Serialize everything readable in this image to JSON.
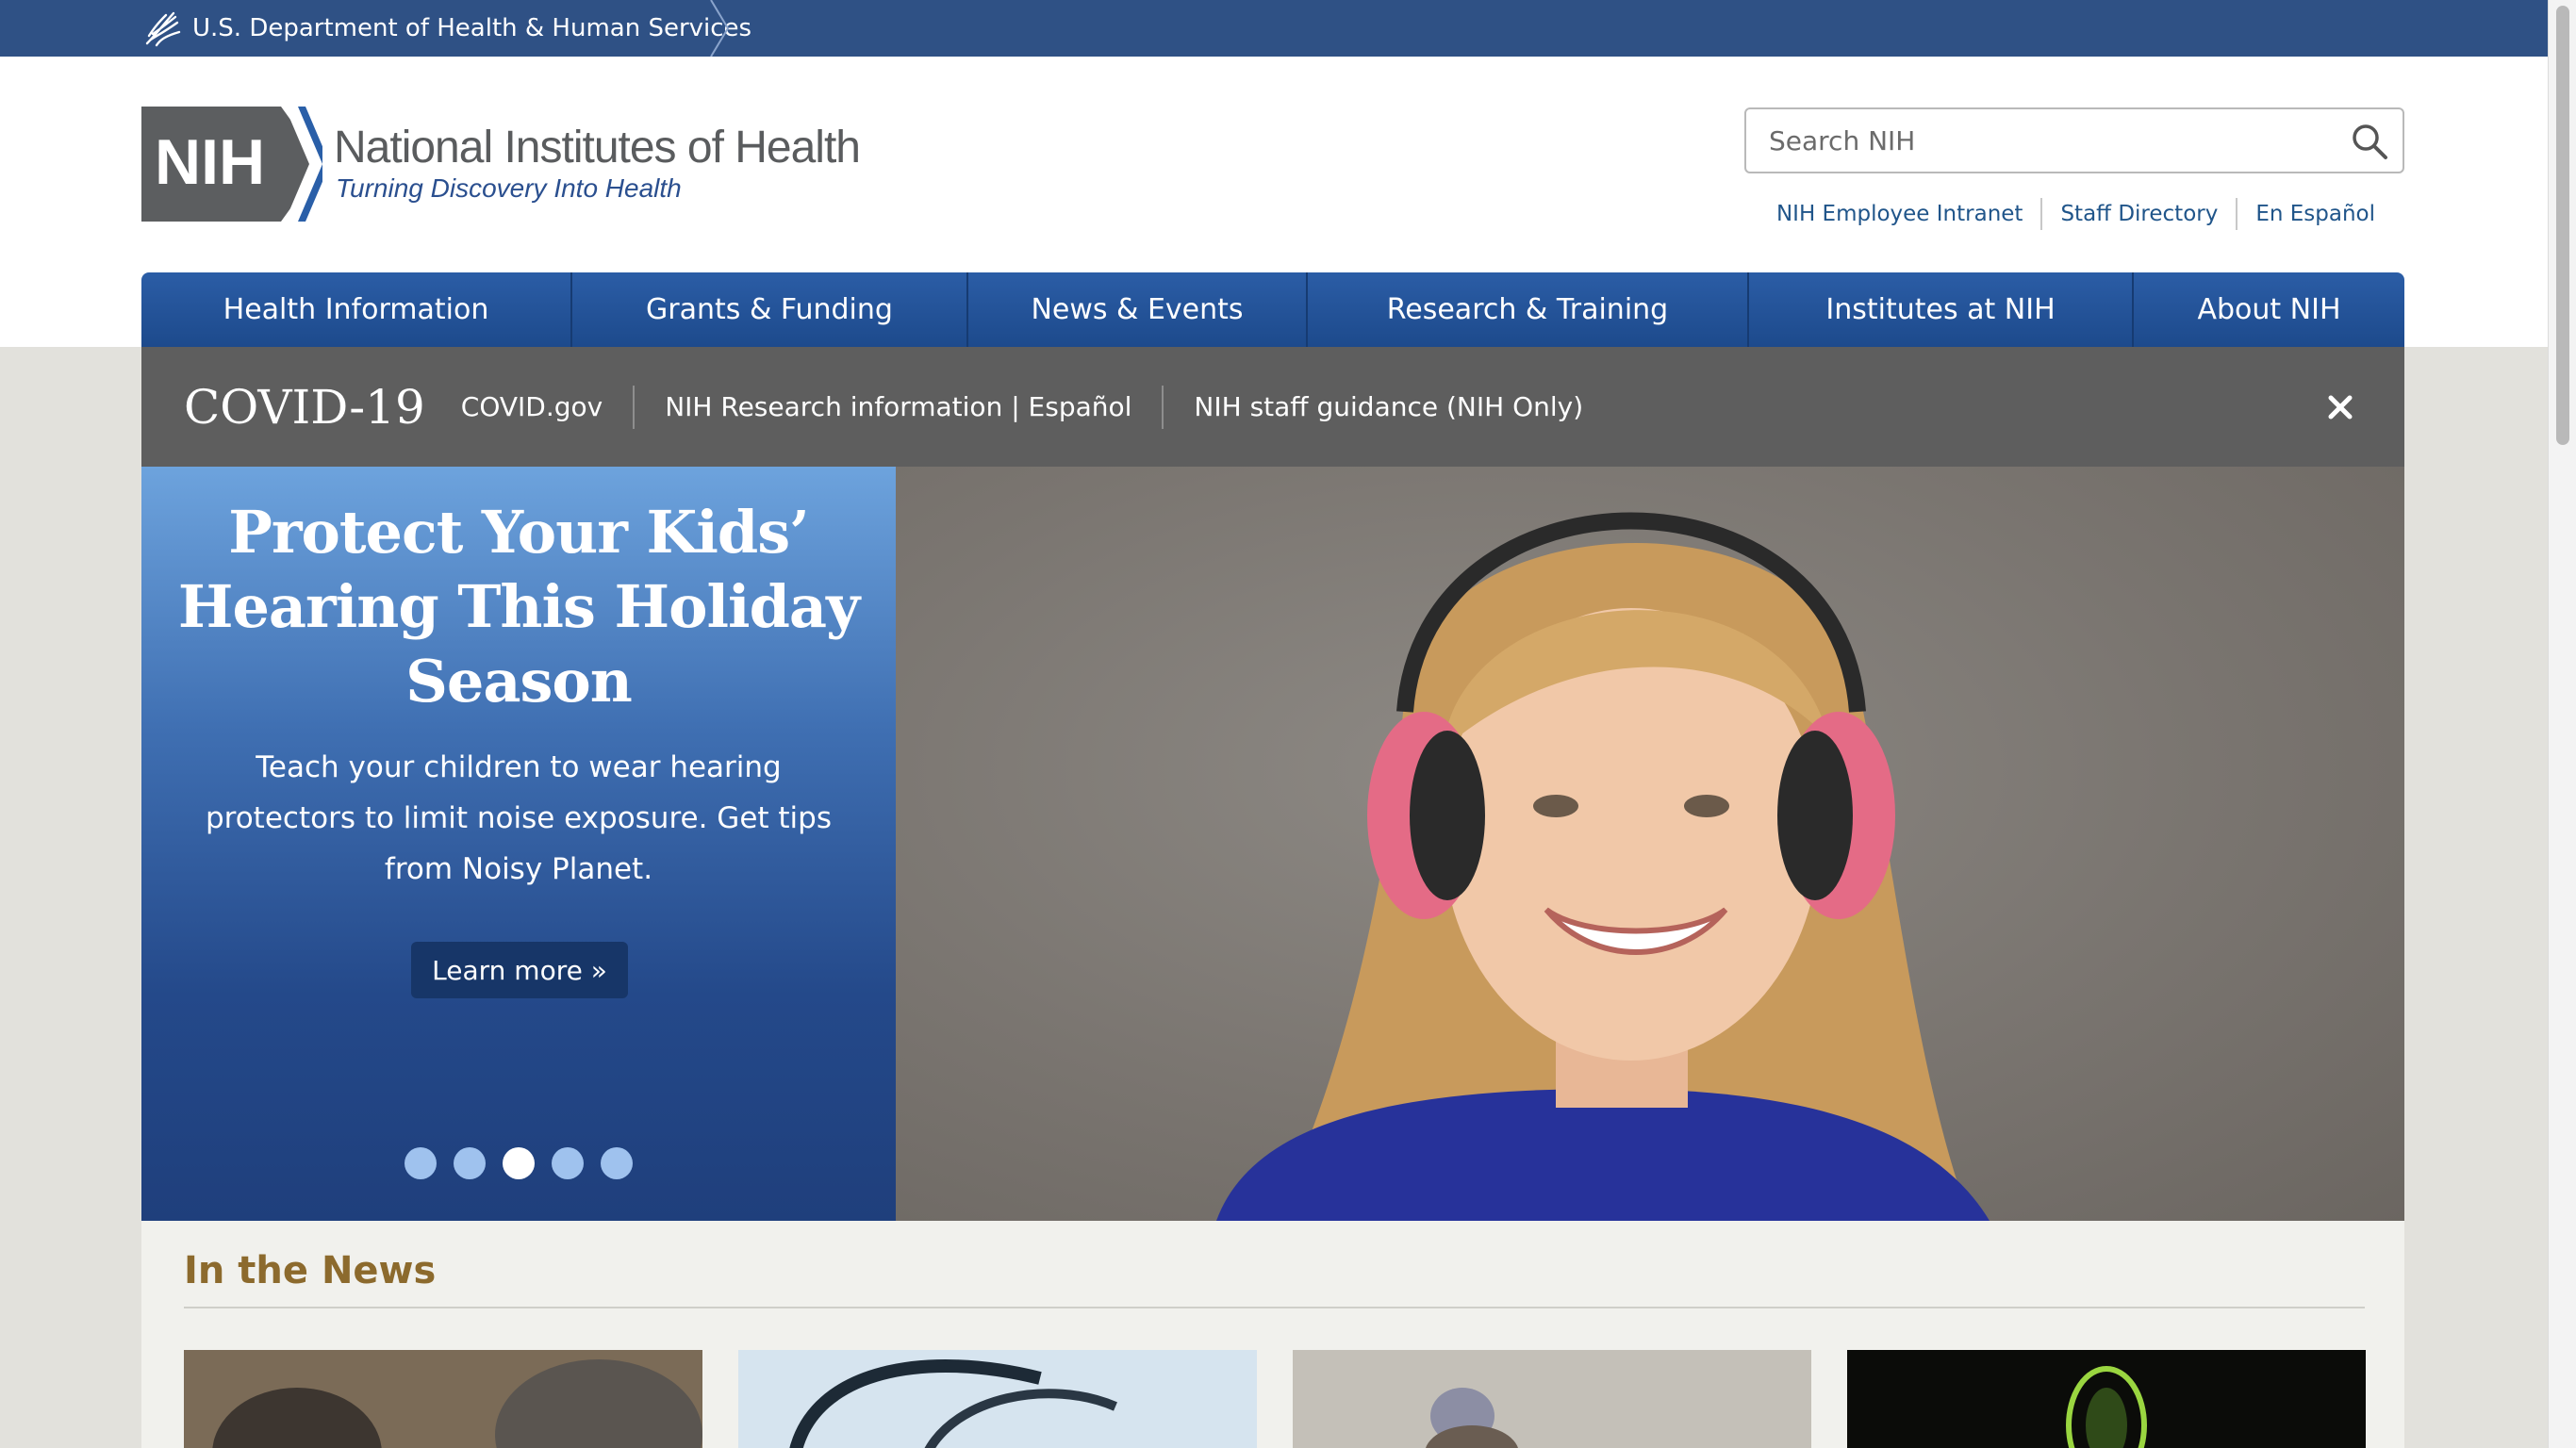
{
  "hhs_bar": {
    "label": "U.S. Department of Health & Human Services"
  },
  "header": {
    "logo_mark": "NIH",
    "logo_title": "National Institutes of Health",
    "logo_tagline": "Turning Discovery Into Health",
    "search_placeholder": "Search NIH",
    "utility_links": [
      "NIH Employee Intranet",
      "Staff Directory",
      "En Español"
    ]
  },
  "nav": {
    "items": [
      "Health Information",
      "Grants & Funding",
      "News & Events",
      "Research & Training",
      "Institutes at NIH",
      "About NIH"
    ]
  },
  "covid": {
    "title": "COVID-19",
    "links": [
      "COVID.gov",
      "NIH Research information | Español",
      "NIH staff guidance (NIH Only)"
    ]
  },
  "hero": {
    "heading": "Protect Your Kids’ Hearing This Holiday Season",
    "text": "Teach your children to wear hearing protectors to limit noise exposure. Get tips from Noisy Planet.",
    "button": "Learn more »",
    "slide_count": 5,
    "active_slide": 3,
    "image_alt": "girl-wearing-pink-hearing-protectors"
  },
  "news": {
    "heading": "In the News"
  },
  "colors": {
    "hhs_bar": "#2f5185",
    "nav": "#2b5da6",
    "covid_bar": "#5e5e5e",
    "hero_panel_top": "#6da3dd",
    "hero_panel_bottom": "#1f3f7c",
    "news_heading": "#8c6a2d",
    "link": "#20558a"
  }
}
